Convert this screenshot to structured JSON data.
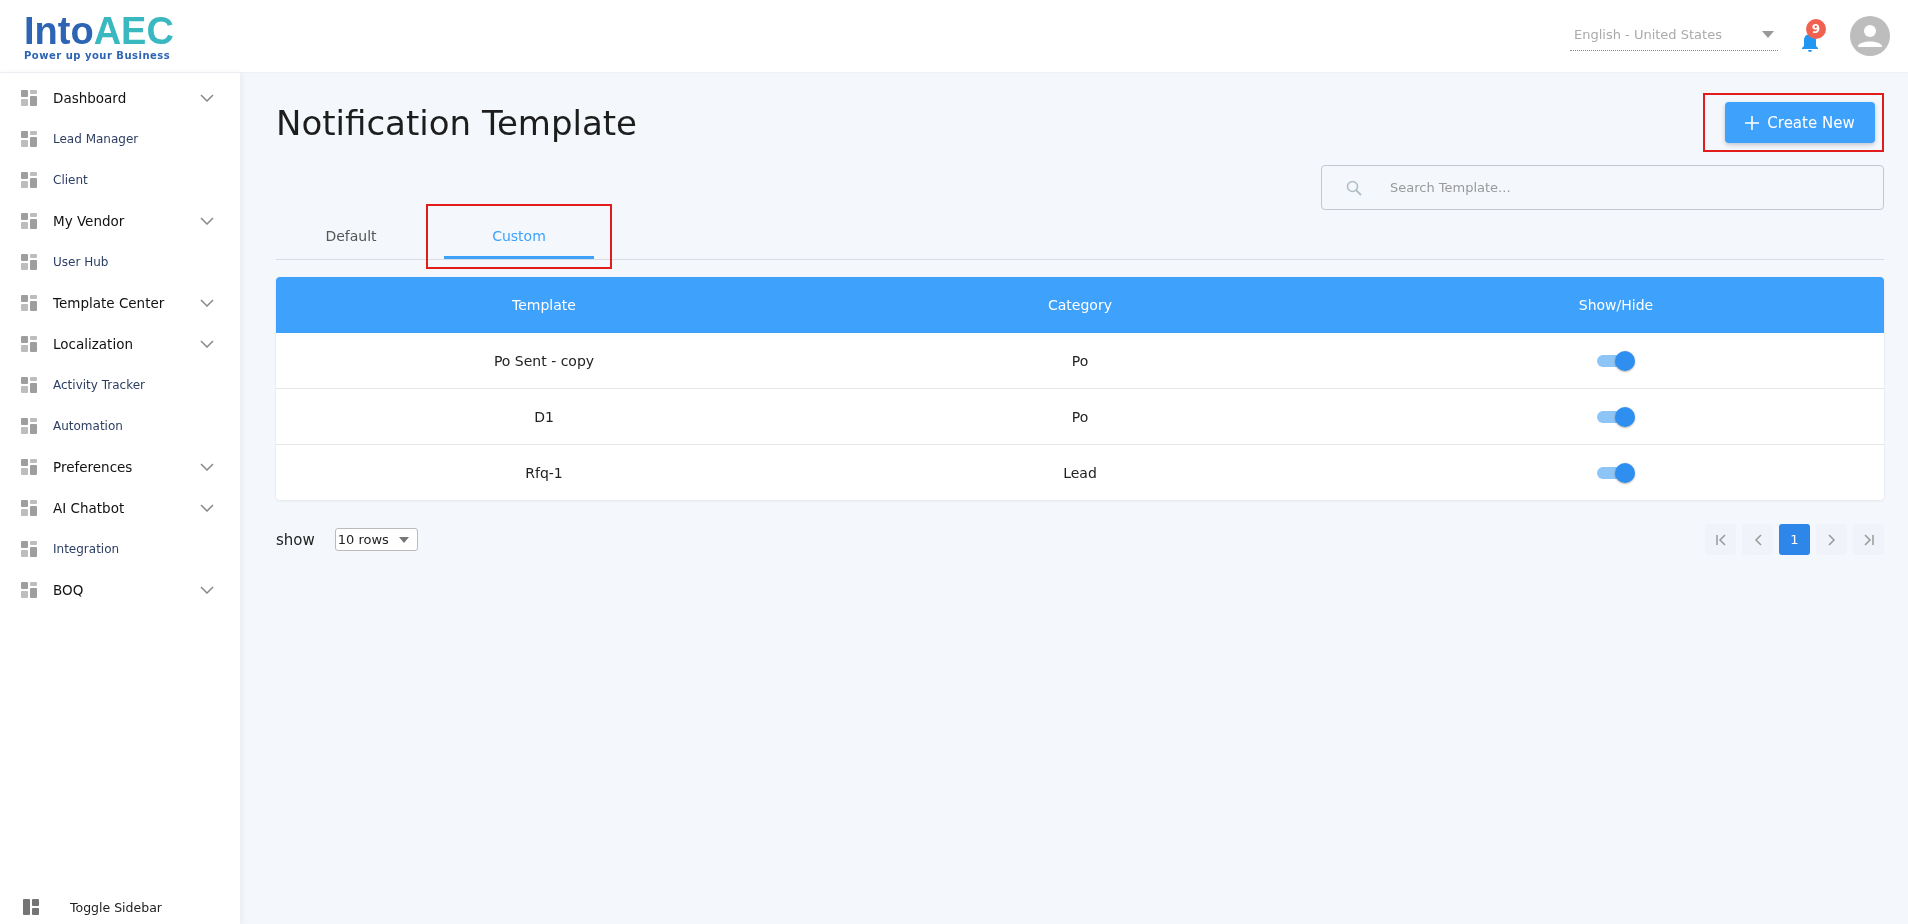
{
  "logo": {
    "name_a": "Into",
    "name_b": "AEC",
    "tagline": "Power up your Business"
  },
  "header": {
    "language": "English - United States",
    "notification_count": "9"
  },
  "sidebar": {
    "items": [
      {
        "label": "Dashboard",
        "expandable": true
      },
      {
        "label": "Lead Manager",
        "expandable": false
      },
      {
        "label": "Client",
        "expandable": false
      },
      {
        "label": "My Vendor",
        "expandable": true
      },
      {
        "label": "User Hub",
        "expandable": false
      },
      {
        "label": "Template Center",
        "expandable": true
      },
      {
        "label": "Localization",
        "expandable": true
      },
      {
        "label": "Activity Tracker",
        "expandable": false
      },
      {
        "label": "Automation",
        "expandable": false
      },
      {
        "label": "Preferences",
        "expandable": true
      },
      {
        "label": "AI Chatbot",
        "expandable": true
      },
      {
        "label": "Integration",
        "expandable": false
      },
      {
        "label": "BOQ",
        "expandable": true
      }
    ],
    "toggle": "Toggle Sidebar"
  },
  "page": {
    "title": "Notification Template",
    "create_button": "Create New",
    "search_placeholder": "Search Template..."
  },
  "tabs": [
    {
      "label": "Default",
      "selected": false,
      "highlighted": false
    },
    {
      "label": "Custom",
      "selected": true,
      "highlighted": true
    }
  ],
  "table": {
    "columns": [
      "Template",
      "Category",
      "Show/Hide"
    ],
    "rows": [
      {
        "template": "Po Sent - copy",
        "category": "Po",
        "on": true
      },
      {
        "template": "D1",
        "category": "Po",
        "on": true
      },
      {
        "template": "Rfq-1",
        "category": "Lead",
        "on": true
      }
    ]
  },
  "footer": {
    "show_label": "show",
    "rows_select": "10 rows",
    "pages": [
      {
        "label": "1",
        "selected": true
      }
    ]
  }
}
